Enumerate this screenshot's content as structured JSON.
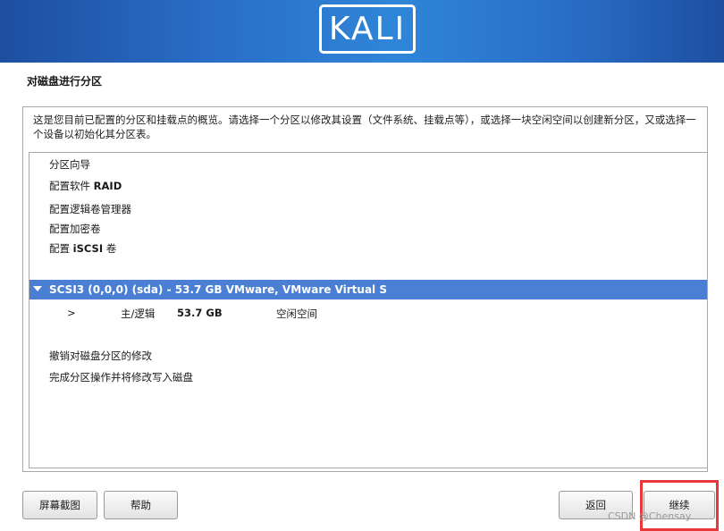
{
  "header": {
    "logo_text": "KALI"
  },
  "page": {
    "title": "对磁盘进行分区",
    "description": "这是您目前已配置的分区和挂载点的概览。请选择一个分区以修改其设置（文件系统、挂载点等），或选择一块空闲空间以创建新分区，又或选择一个设备以初始化其分区表。"
  },
  "list": {
    "guided": "分区向导",
    "raid_prefix": "配置软件",
    "raid_strong": "RAID",
    "lvm": "配置逻辑卷管理器",
    "encrypted": "配置加密卷",
    "iscsi_prefix": "配置",
    "iscsi_strong": "iSCSI",
    "iscsi_suffix": "卷",
    "device": "SCSI3 (0,0,0) (sda) - 53.7 GB VMware, VMware Virtual S",
    "partition": {
      "marker": ">",
      "type": "主/逻辑",
      "size": "53.7 GB",
      "usage": "空闲空间"
    },
    "undo": "撤销对磁盘分区的修改",
    "finish": "完成分区操作并将修改写入磁盘"
  },
  "buttons": {
    "screenshot": "屏幕截图",
    "help": "帮助",
    "back": "返回",
    "continue": "继续"
  },
  "watermark": "CSDN @Chensay.",
  "colors": {
    "header_blue": "#2a6ec8",
    "selection_blue": "#4a7fd4",
    "highlight_red": "#e8383a"
  }
}
